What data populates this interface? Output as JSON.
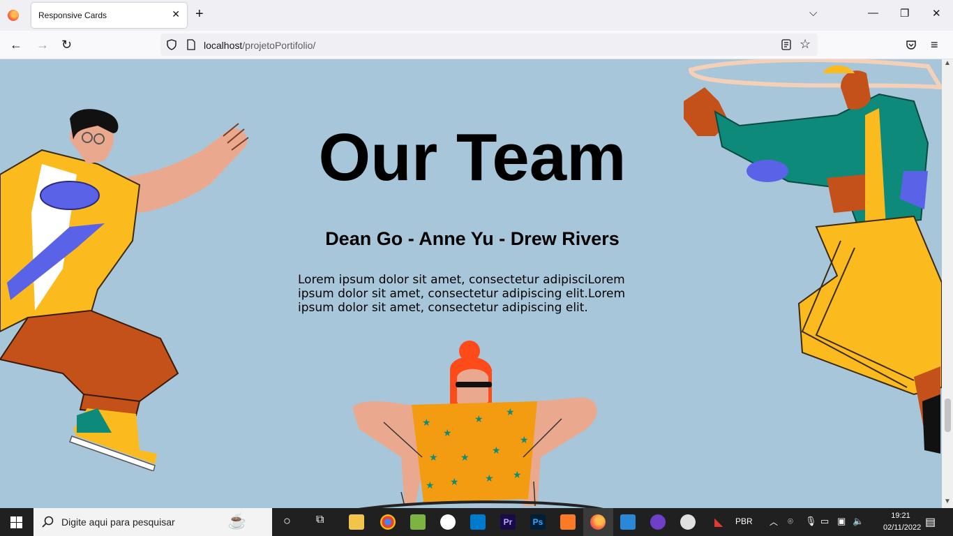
{
  "browser": {
    "tab_title": "Responsive Cards",
    "tab_close": "✕",
    "new_tab": "+",
    "url_host": "localhost",
    "url_path": "/projetoPortifolio/"
  },
  "page": {
    "title": "Our Team",
    "names": "Dean Go - Anne Yu - Drew Rivers",
    "paragraph": "Lorem ipsum dolor sit amet, consectetur adipisciLorem ipsum dolor sit amet, consectetur adipiscing elit.Lorem ipsum dolor sit amet, consectetur adipiscing elit."
  },
  "taskbar": {
    "search_placeholder": "Digite aqui para pesquisar",
    "language": "PBR",
    "time": "19:21",
    "date": "02/11/2022"
  },
  "colors": {
    "page_bg": "#a8c6da",
    "skin": "#eaa98e",
    "yellow": "#fbbb1f",
    "rust": "#c4501a",
    "teal": "#0e8a7a",
    "blue": "#5a63e8"
  }
}
